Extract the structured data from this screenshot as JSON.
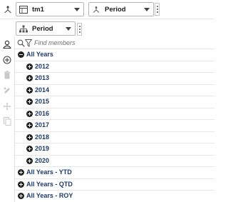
{
  "toolbar": {
    "dim_icon": "hierarchy-icon",
    "cube": {
      "icon": "table-icon",
      "label": "tm1"
    },
    "dimension": {
      "icon": "hierarchy-icon",
      "label": "Period"
    }
  },
  "subset": {
    "icon": "tree-icon",
    "label": "Period"
  },
  "sidebar": {
    "icons": [
      "user-icon",
      "add-circle-icon",
      "trash-icon",
      "edit-icon",
      "move-icon",
      "copy-icon"
    ]
  },
  "search": {
    "placeholder": "Find members"
  },
  "tree": {
    "root": {
      "label": "All Years",
      "state": "expanded"
    },
    "children": [
      {
        "label": "2012"
      },
      {
        "label": "2013"
      },
      {
        "label": "2014"
      },
      {
        "label": "2015"
      },
      {
        "label": "2016"
      },
      {
        "label": "2017"
      },
      {
        "label": "2018"
      },
      {
        "label": "2019"
      },
      {
        "label": "2020"
      }
    ],
    "siblings": [
      {
        "label": "All Years - YTD"
      },
      {
        "label": "All Years - QTD"
      },
      {
        "label": "All Years - ROY"
      }
    ]
  },
  "colors": {
    "member_text": "#1e3a6e",
    "disabled_icon": "#c8c8c8"
  }
}
